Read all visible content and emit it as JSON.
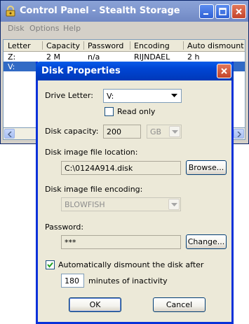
{
  "main_window": {
    "title": "Control Panel - Stealth Storage",
    "menu": [
      "Disk",
      "Options",
      "Help"
    ],
    "columns": [
      "Letter",
      "Capacity",
      "Password",
      "Encoding",
      "Auto dismount"
    ],
    "rows": [
      {
        "letter": "Z:",
        "capacity": "2 M",
        "password": "n/a",
        "encoding": "RIJNDAEL",
        "auto_dismount": "2 h"
      },
      {
        "letter": "V:",
        "capacity": "",
        "password": "",
        "encoding": "",
        "auto_dismount": ""
      }
    ],
    "selected_row": 1
  },
  "dialog": {
    "title": "Disk Properties",
    "drive_letter_label": "Drive Letter:",
    "drive_letter_value": "V:",
    "read_only_label": "Read only",
    "read_only_checked": false,
    "capacity_label": "Disk capacity:",
    "capacity_value": "200",
    "capacity_unit": "GB",
    "location_label": "Disk image file location:",
    "location_value": "C:\\0124A914.disk",
    "browse_label": "Browse...",
    "encoding_label": "Disk image file encoding:",
    "encoding_value": "BLOWFISH",
    "password_label": "Password:",
    "password_value": "***",
    "change_label": "Change...",
    "auto_dismount_label": "Automatically dismount the disk after",
    "auto_dismount_checked": true,
    "minutes_value": "180",
    "minutes_label": "minutes of inactivity",
    "ok_label": "OK",
    "cancel_label": "Cancel"
  },
  "colors": {
    "title_active": "#0046d5",
    "title_inactive": "#7f97cf",
    "selection": "#316ac5",
    "dialog_face": "#ece9d8",
    "window_face": "#d4d0c8"
  },
  "icons": [
    "lock-app-icon",
    "minimize-icon",
    "maximize-icon",
    "close-icon",
    "dropdown-arrow-icon",
    "checkmark-icon",
    "scroll-left-icon",
    "scroll-right-icon"
  ]
}
